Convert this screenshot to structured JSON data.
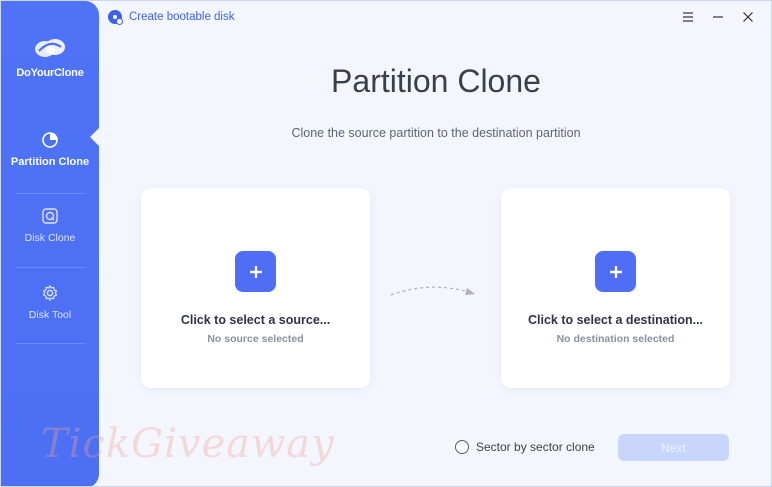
{
  "app": {
    "name": "DoYourClone"
  },
  "topbar": {
    "bootable_label": "Create bootable disk"
  },
  "sidebar": {
    "items": [
      {
        "label": "Partition Clone",
        "icon": "pie-chart-icon",
        "active": true
      },
      {
        "label": "Disk Clone",
        "icon": "disk-icon",
        "active": false
      },
      {
        "label": "Disk Tool",
        "icon": "gear-icon",
        "active": false
      }
    ]
  },
  "main": {
    "title": "Partition Clone",
    "subtitle": "Clone the source partition to the destination partition",
    "source": {
      "title": "Click to select a source...",
      "status": "No source selected"
    },
    "destination": {
      "title": "Click to select a destination...",
      "status": "No destination selected"
    }
  },
  "footer": {
    "sector_label": "Sector by sector clone",
    "sector_checked": false,
    "next_label": "Next"
  },
  "watermark": "TickGiveaway",
  "colors": {
    "accent": "#4f6ef5",
    "sidebar": "#4f73f6",
    "background": "#f3f6fd",
    "next_disabled": "#c9d6fb"
  }
}
